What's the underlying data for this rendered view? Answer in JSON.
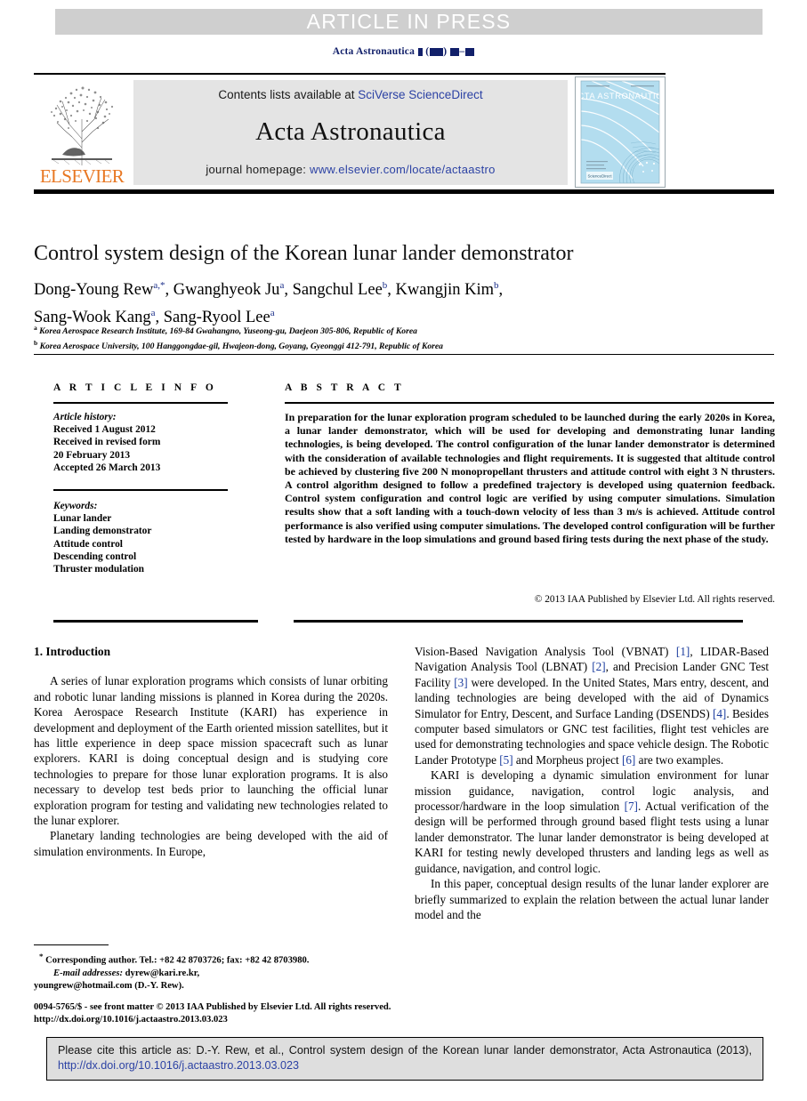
{
  "banner": {
    "article_in_press": "ARTICLE IN PRESS"
  },
  "running_head": {
    "journal": "Acta Astronautica"
  },
  "masthead": {
    "contents_prefix": "Contents lists available at ",
    "sciencedirect": "SciVerse ScienceDirect",
    "journal_title": "Acta Astronautica",
    "homepage_prefix": "journal homepage: ",
    "homepage_url": "www.elsevier.com/locate/actaastro",
    "publisher_logo": "ELSEVIER",
    "cover_title": "ACTA ASTRONAUTICA",
    "colors": {
      "elsevier_orange": "#e87722",
      "link_blue": "#2c42a4",
      "runhead_navy": "#12206a",
      "banner_gray": "#e4e4e4",
      "cover_blue": "#aedcf0"
    }
  },
  "article": {
    "title": "Control system design of the Korean lunar lander demonstrator",
    "authors_line_1": "Dong-Young Rew a,*, Gwanghyeok Ju a, Sangchul Lee b, Kwangjin Kim b,",
    "authors_line_2": "Sang-Wook Kang a, Sang-Ryool Lee a",
    "authors": [
      {
        "name": "Dong-Young Rew",
        "marks": "a,*"
      },
      {
        "name": "Gwanghyeok Ju",
        "marks": "a"
      },
      {
        "name": "Sangchul Lee",
        "marks": "b"
      },
      {
        "name": "Kwangjin Kim",
        "marks": "b"
      },
      {
        "name": "Sang-Wook Kang",
        "marks": "a"
      },
      {
        "name": "Sang-Ryool Lee",
        "marks": "a"
      }
    ],
    "affiliations": [
      {
        "mark": "a",
        "text": "Korea Aerospace Research Institute, 169-84 Gwahangno, Yuseong-gu, Daejeon 305-806, Republic of Korea"
      },
      {
        "mark": "b",
        "text": "Korea Aerospace University, 100 Hanggongdae-gil, Hwajeon-dong, Goyang, Gyeonggi 412-791, Republic of Korea"
      }
    ]
  },
  "article_info": {
    "heading": "A R T I C L E  I N F O",
    "history_label": "Article history:",
    "history": [
      "Received 1 August 2012",
      "Received in revised form",
      "20 February 2013",
      "Accepted 26 March 2013"
    ],
    "keywords_label": "Keywords:",
    "keywords": [
      "Lunar lander",
      "Landing demonstrator",
      "Attitude control",
      "Descending control",
      "Thruster modulation"
    ]
  },
  "abstract": {
    "heading": "A B S T R A C T",
    "text": "In preparation for the lunar exploration program scheduled to be launched during the early 2020s in Korea, a lunar lander demonstrator, which will be used for developing and demonstrating lunar landing technologies, is being developed. The control configuration of the lunar lander demonstrator is determined with the consideration of available technologies and flight requirements. It is suggested that altitude control be achieved by clustering five 200 N monopropellant thrusters and attitude control with eight 3 N thrusters. A control algorithm designed to follow a predefined trajectory is developed using quaternion feedback. Control system configuration and control logic are verified by using computer simulations. Simulation results show that a soft landing with a touch-down velocity of less than 3 m/s is achieved. Attitude control performance is also verified using computer simulations. The developed control configuration will be further tested by hardware in the loop simulations and ground based firing tests during the next phase of the study.",
    "copyright": "© 2013 IAA Published by Elsevier Ltd. All rights reserved."
  },
  "body": {
    "section_heading": "1. Introduction",
    "left_paragraphs": [
      "A series of lunar exploration programs which consists of lunar orbiting and robotic lunar landing missions is planned in Korea during the 2020s. Korea Aerospace Research Institute (KARI) has experience in development and deployment of the Earth oriented mission satellites, but it has little experience in deep space mission spacecraft such as lunar explorers. KARI is doing conceptual design and is studying core technologies to prepare for those lunar exploration programs. It is also necessary to develop test beds prior to launching the official lunar exploration program for testing and validating new technologies related to the lunar explorer.",
      "Planetary landing technologies are being developed with the aid of simulation environments. In Europe,"
    ],
    "right_paragraph_1_parts": [
      {
        "t": "Vision-Based Navigation Analysis Tool (VBNAT) ",
        "ref": false
      },
      {
        "t": "[1]",
        "ref": true
      },
      {
        "t": ", LIDAR-Based Navigation Analysis Tool (LBNAT) ",
        "ref": false
      },
      {
        "t": "[2]",
        "ref": true
      },
      {
        "t": ", and Precision Lander GNC Test Facility ",
        "ref": false
      },
      {
        "t": "[3]",
        "ref": true
      },
      {
        "t": " were developed. In the United States, Mars entry, descent, and landing technologies are being developed with the aid of Dynamics Simulator for Entry, Descent, and Surface Landing (DSENDS) ",
        "ref": false
      },
      {
        "t": "[4]",
        "ref": true
      },
      {
        "t": ". Besides computer based simulators or GNC test facilities, flight test vehicles are used for demonstrating technologies and space vehicle design. The Robotic Lander Prototype ",
        "ref": false
      },
      {
        "t": "[5]",
        "ref": true
      },
      {
        "t": " and Morpheus project ",
        "ref": false
      },
      {
        "t": "[6]",
        "ref": true
      },
      {
        "t": " are two examples.",
        "ref": false
      }
    ],
    "right_paragraph_2_parts": [
      {
        "t": "KARI is developing a dynamic simulation environment for lunar mission guidance, navigation, control logic analysis, and processor/hardware in the loop simulation ",
        "ref": false
      },
      {
        "t": "[7]",
        "ref": true
      },
      {
        "t": ". Actual verification of the design will be performed through ground based flight tests using a lunar lander demonstrator. The lunar lander demonstrator is being developed at KARI for testing newly developed thrusters and landing legs as well as guidance, navigation, and control logic.",
        "ref": false
      }
    ],
    "right_paragraph_3": "In this paper, conceptual design results of the lunar lander explorer are briefly summarized to explain the relation between the actual lunar lander model and the"
  },
  "footer": {
    "corresponding_mark": "*",
    "corresponding": "Corresponding author. Tel.: +82 42 8703726; fax: +82 42 8703980.",
    "email_label": "E-mail addresses:",
    "emails": "dyrew@kari.re.kr,",
    "emails_line2": "youngrew@hotmail.com (D.-Y. Rew).",
    "issn_line": "0094-5765/$ - see front matter © 2013 IAA Published by Elsevier Ltd. All rights reserved.",
    "doi_line": "http://dx.doi.org/10.1016/j.actaastro.2013.03.023"
  },
  "cite_box": {
    "text_prefix": "Please cite this article as: D.-Y. Rew, et al., Control system design of the Korean lunar lander demonstrator, Acta Astronautica (2013), ",
    "doi_link": "http://dx.doi.org/10.1016/j.actaastro.2013.03.023"
  }
}
